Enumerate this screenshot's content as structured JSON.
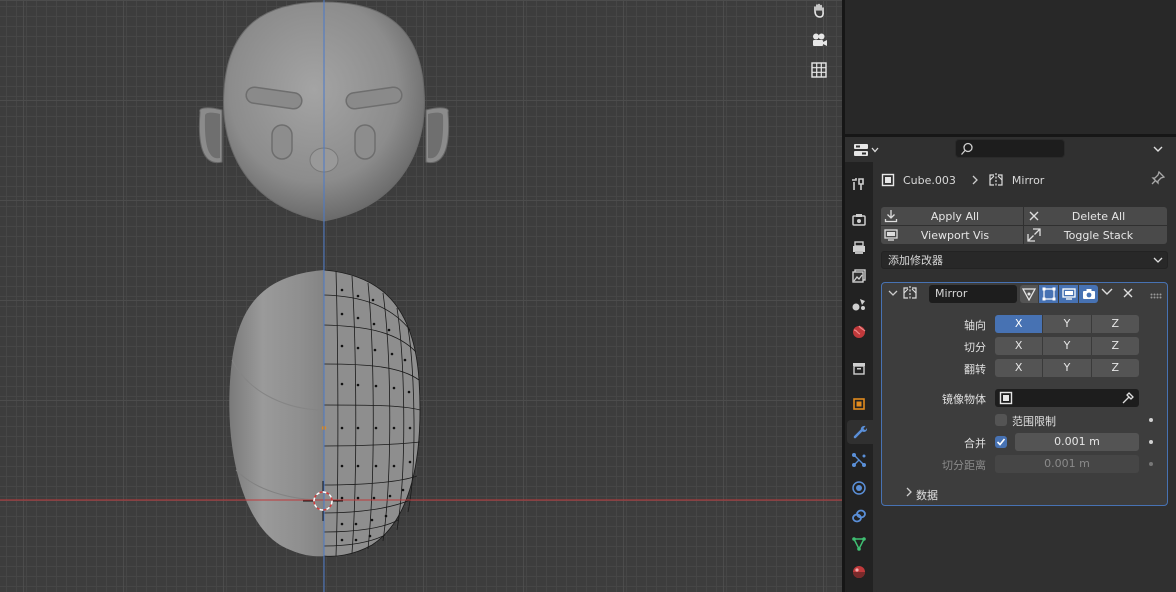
{
  "viewport": {
    "tool_icons": [
      "hand-icon",
      "camera-icon",
      "grid-icon"
    ]
  },
  "properties": {
    "search_placeholder": "",
    "breadcrumb": {
      "object": "Cube.003",
      "modifier": "Mirror"
    },
    "buttons": {
      "apply_all": "Apply All",
      "delete_all": "Delete All",
      "viewport_vis": "Viewport Vis",
      "toggle_stack": "Toggle Stack"
    },
    "add_modifier": "添加修改器",
    "modifier": {
      "name": "Mirror",
      "axis_label": "轴向",
      "bisect_label": "切分",
      "flip_label": "翻转",
      "axes": [
        "X",
        "Y",
        "Z"
      ],
      "axis_active": [
        true,
        false,
        false
      ],
      "mirror_object_label": "镜像物体",
      "clipping_label": "范围限制",
      "clipping": false,
      "merge_label": "合并",
      "merge": true,
      "merge_value": "0.001 m",
      "bisect_distance_label": "切分距离",
      "bisect_distance_value": "0.001 m",
      "data_label": "数据"
    },
    "tabs": [
      "tool-icon",
      "render-icon",
      "output-icon",
      "view-layer-icon",
      "scene-icon",
      "world-icon",
      "collection-icon",
      "object-icon",
      "modifier-icon",
      "particles-icon",
      "physics-icon",
      "constraints-icon",
      "data-icon",
      "material-icon"
    ],
    "active_tab": "modifier-icon"
  },
  "colors": {
    "accent": "#4772b3",
    "x_axis": "#c0393b",
    "y_axis": "#4a79c9"
  }
}
